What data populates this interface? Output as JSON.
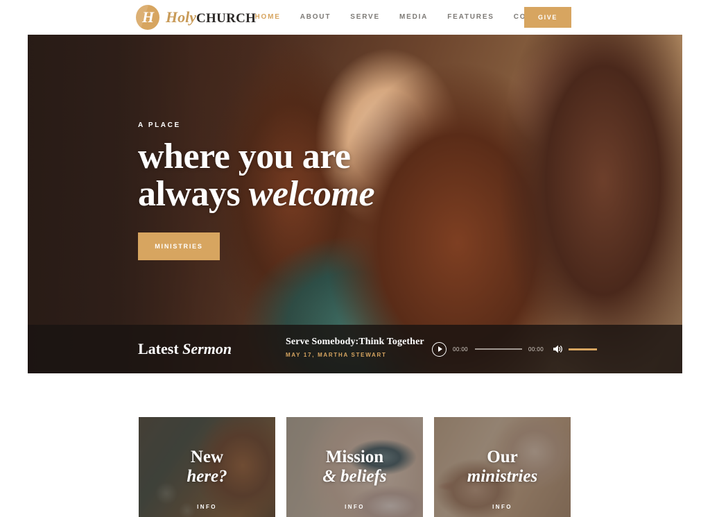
{
  "header": {
    "brand": {
      "mark_letter": "H",
      "name_italic": "Holy",
      "name_bold": "CHURCH"
    },
    "nav": [
      {
        "label": "HOME",
        "active": true
      },
      {
        "label": "ABOUT",
        "active": false
      },
      {
        "label": "SERVE",
        "active": false
      },
      {
        "label": "MEDIA",
        "active": false
      },
      {
        "label": "FEATURES",
        "active": false
      },
      {
        "label": "CONTACTS",
        "active": false
      }
    ],
    "give_label": "GIVE"
  },
  "hero": {
    "eyebrow": "A PLACE",
    "title_line1": "where you are",
    "title_line2_plain": "always ",
    "title_line2_italic": "welcome",
    "cta_label": "MINISTRIES"
  },
  "sermon": {
    "heading_plain": "Latest ",
    "heading_italic": "Sermon",
    "title": "Serve Somebody:Think Together",
    "meta": "MAY 17, MARTHA STEWART",
    "player": {
      "play_icon": "play-icon",
      "current_time": "00:00",
      "duration": "00:00",
      "volume_icon": "speaker-icon"
    }
  },
  "cards": [
    {
      "title_plain": "New",
      "title_italic": "here?",
      "info_label": "INFO"
    },
    {
      "title_plain": "Mission",
      "title_italic": "& beliefs",
      "info_label": "INFO"
    },
    {
      "title_plain": "Our",
      "title_italic": "ministries",
      "info_label": "INFO"
    }
  ],
  "colors": {
    "accent_gold": "#d7a560",
    "nav_text": "#7d7a76",
    "dark_overlay": "#1a1411"
  }
}
